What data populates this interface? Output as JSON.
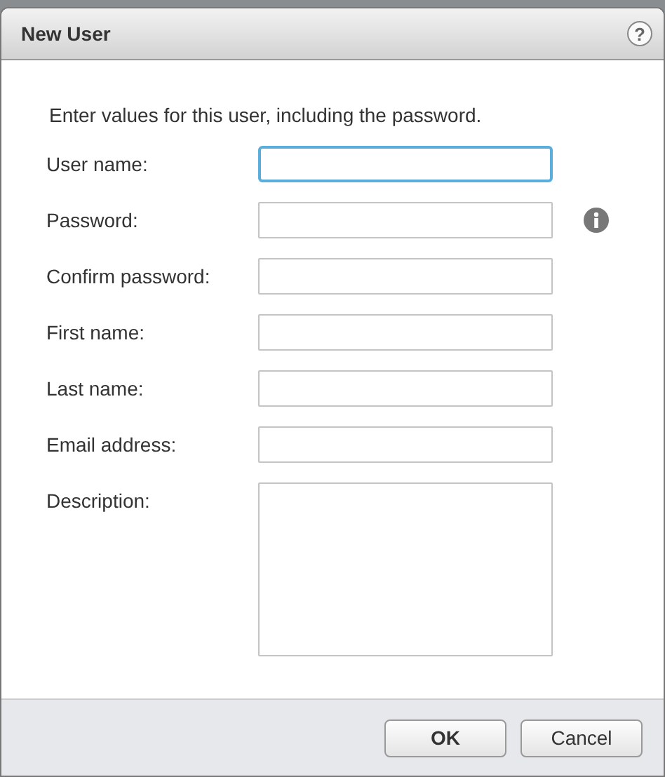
{
  "dialog": {
    "title": "New User",
    "help": "?"
  },
  "intro": "Enter values for this user, including the password.",
  "fields": [
    {
      "label": "User name:",
      "kind": "text",
      "focused": true,
      "info": false
    },
    {
      "label": "Password:",
      "kind": "text",
      "focused": false,
      "info": true
    },
    {
      "label": "Confirm password:",
      "kind": "text",
      "focused": false,
      "info": false
    },
    {
      "label": "First name:",
      "kind": "text",
      "focused": false,
      "info": false
    },
    {
      "label": "Last name:",
      "kind": "text",
      "focused": false,
      "info": false
    },
    {
      "label": "Email address:",
      "kind": "text",
      "focused": false,
      "info": false
    },
    {
      "label": "Description:",
      "kind": "textarea",
      "focused": false,
      "info": false
    }
  ],
  "buttons": [
    "OK",
    "Cancel"
  ]
}
